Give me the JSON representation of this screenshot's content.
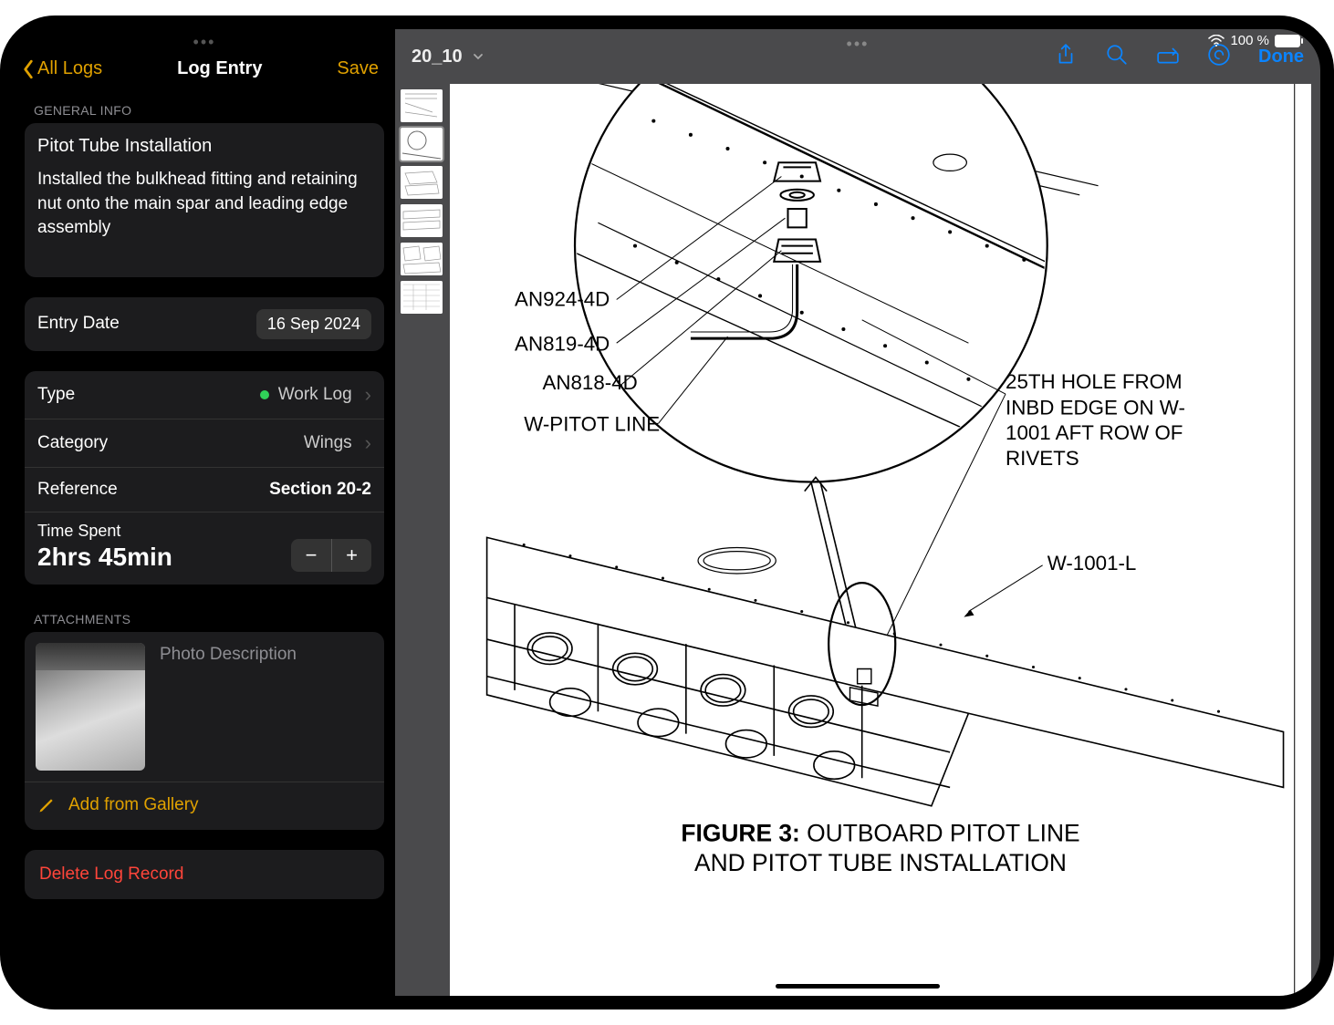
{
  "leftPanel": {
    "back": "All Logs",
    "title": "Log Entry",
    "save": "Save",
    "sections": {
      "generalInfo": "General Info",
      "attachments": "Attachments"
    },
    "entry": {
      "title": "Pitot Tube Installation",
      "body": "Installed the bulkhead fitting and retaining nut onto the main spar and leading edge assembly"
    },
    "entryDate": {
      "label": "Entry Date",
      "value": "16 Sep 2024"
    },
    "type": {
      "label": "Type",
      "value": "Work Log"
    },
    "category": {
      "label": "Category",
      "value": "Wings"
    },
    "reference": {
      "label": "Reference",
      "value": "Section 20-2"
    },
    "timeSpent": {
      "label": "Time Spent",
      "value": "2hrs 45min"
    },
    "photoDesc": "Photo Description",
    "addGallery": "Add from Gallery",
    "delete": "Delete Log Record"
  },
  "rightPanel": {
    "docName": "20_10",
    "done": "Done",
    "battery": "100 %",
    "figure": {
      "label": "FIGURE 3:",
      "caption1": "OUTBOARD PITOT LINE",
      "caption2": "AND PITOT TUBE INSTALLATION"
    },
    "annotations": {
      "a1": "AN924-4D",
      "a2": "AN819-4D",
      "a3": "AN818-4D",
      "a4": "W-PITOT LINE",
      "a5": "25TH HOLE FROM INBD EDGE ON W-1001 AFT ROW OF RIVETS",
      "a6": "W-1001-L"
    }
  }
}
